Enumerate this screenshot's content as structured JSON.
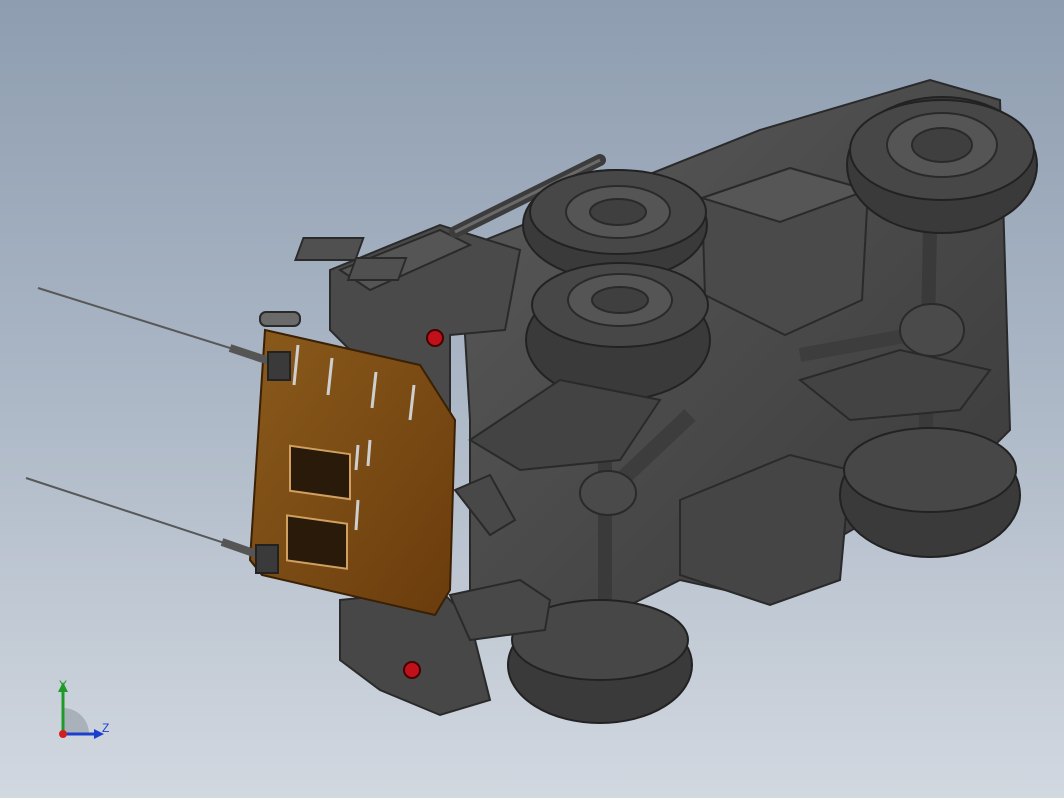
{
  "viewport": {
    "background_top": "#8e9db0",
    "background_bottom": "#d2d8e0",
    "model": "armored-vehicle-underside-view"
  },
  "triad": {
    "y_label": "Y",
    "z_label": "Z",
    "y_color": "#1f9a2a",
    "z_color": "#1a3fcf",
    "origin_color": "#d02020"
  },
  "colors": {
    "body_dark": "#3f3f3f",
    "body_mid": "#4d4d4d",
    "body_light": "#5e5e5e",
    "tire": "#3a3a3a",
    "panel_orange": "#7a4a12",
    "reflector_red": "#c0101a"
  }
}
